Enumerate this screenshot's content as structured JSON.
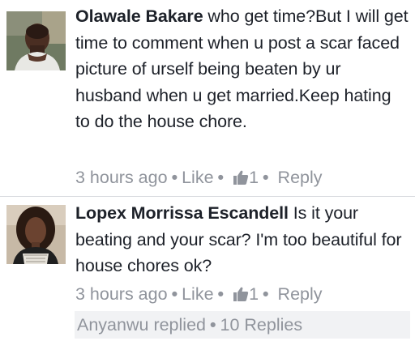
{
  "comments": [
    {
      "author": "Olawale Bakare",
      "text": " who get time?But I will get time to comment when u post a scar faced picture of urself being beaten by ur husband when u get married.Keep hating to do the house chore.",
      "time": "3 hours ago",
      "like_label": "Like",
      "like_count": "1",
      "reply_label": "Reply",
      "avatar_icon": "male-avatar-photo"
    },
    {
      "author": "Lopex Morrissa Escandell",
      "text": " Is it your beating and your scar?  I'm too beautiful for house chores ok?",
      "time": "3 hours ago",
      "like_label": "Like",
      "like_count": "1",
      "reply_label": "Reply",
      "avatar_icon": "female-avatar-photo"
    }
  ],
  "replies": {
    "replier": "Anyanwu",
    "replied_label": "replied",
    "count_label": "10 Replies"
  },
  "icons": {
    "like": "thumbs-up-icon"
  },
  "colors": {
    "text": "#1d2129",
    "meta": "#90949c",
    "divider": "#d8dadf",
    "replies_bg": "#f1f2f4"
  }
}
